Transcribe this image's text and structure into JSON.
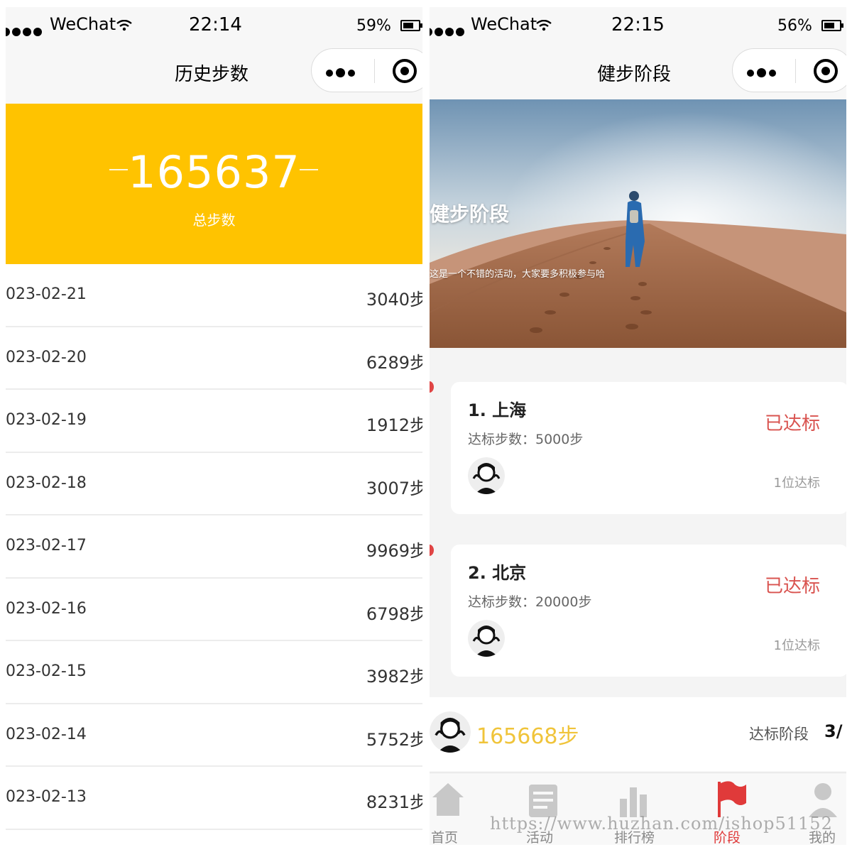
{
  "left": {
    "status": {
      "carrier": "WeChat",
      "time": "22:14",
      "battery": "59%"
    },
    "title": "历史步数",
    "total": {
      "value": "165637",
      "label": "总步数"
    },
    "history": [
      {
        "date": "023-02-21",
        "steps": "3040步"
      },
      {
        "date": "023-02-20",
        "steps": "6289步"
      },
      {
        "date": "023-02-19",
        "steps": "1912步"
      },
      {
        "date": "023-02-18",
        "steps": "3007步"
      },
      {
        "date": "023-02-17",
        "steps": "9969步"
      },
      {
        "date": "023-02-16",
        "steps": "6798步"
      },
      {
        "date": "023-02-15",
        "steps": "3982步"
      },
      {
        "date": "023-02-14",
        "steps": "5752步"
      },
      {
        "date": "023-02-13",
        "steps": "8231步"
      }
    ]
  },
  "right": {
    "status": {
      "carrier": "WeChat",
      "time": "22:15",
      "battery": "56%"
    },
    "title": "健步阶段",
    "hero": {
      "title": "健步阶段",
      "desc": "这是一个不错的活动，大家要多积极参与哈"
    },
    "stages": [
      {
        "name": "1. 上海",
        "requirement": "达标步数：5000步",
        "status": "已达标",
        "count": "1位达标"
      },
      {
        "name": "2. 北京",
        "requirement": "达标步数：20000步",
        "status": "已达标",
        "count": "1位达标"
      }
    ],
    "summary": {
      "steps": "165668步",
      "label": "达标阶段",
      "value": "3/"
    },
    "tabs": [
      {
        "label": "首页",
        "icon": "home-icon"
      },
      {
        "label": "活动",
        "icon": "document-icon"
      },
      {
        "label": "排行榜",
        "icon": "bar-chart-icon"
      },
      {
        "label": "阶段",
        "icon": "flag-icon",
        "active": true
      },
      {
        "label": "我的",
        "icon": "user-icon"
      }
    ]
  },
  "watermark": "https://www.huzhan.com/ishop51152",
  "colors": {
    "accent_yellow": "#ffc300",
    "status_red": "#d9534f",
    "active_tab": "#e03a3a",
    "summary_steps": "#f0c43a"
  }
}
